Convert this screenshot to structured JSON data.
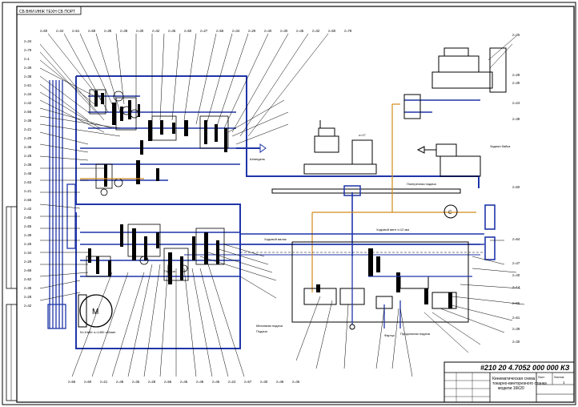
{
  "stamp_top": "СБ ВНИ ИНЖ ТЕХН СБ ПОРТ",
  "doc_code": "#210 20 4.7052 000 000 КЗ",
  "title_block": {
    "title_line1": "Кинематическая схема",
    "title_line2": "токарно-винторезного станка",
    "title_line3": "модели 16К20",
    "sheet_label": "Лист",
    "sheets_label": "Листов",
    "sheet_no": "1",
    "scale": "1:1"
  },
  "callouts": {
    "mechanism_feed": "Механизм подачи",
    "mechanism_feed2": "Подачи",
    "lead_screw": "Ходовой винт",
    "feed_rod": "Ходовой валик",
    "feed_rod2": "Ходовой валик Рn=2.17мм",
    "feed_screw": "Ходовой винт t=12 мм",
    "apron": "Фартук",
    "spindle": "Шпиндель",
    "tailstock": "Задняя бабка",
    "motor": "М",
    "motor_spec": "N=10кВт n=1450 об/мин",
    "tool_feed": "Подача",
    "cross_feed": "Поперечная подача",
    "long_feed": "Продольная подача"
  },
  "left_labels": [
    "z=34",
    "z=79",
    "z=1",
    "z=39",
    "z=38",
    "z=51",
    "z=34",
    "z=42",
    "z=56",
    "z=38",
    "z=21",
    "z=29",
    "z=38",
    "z=28",
    "z=38",
    "z=48",
    "z=53",
    "z=21",
    "z=56",
    "z=42",
    "z=65",
    "z=55",
    "z=39",
    "z=26",
    "z=34",
    "z=29",
    "z=68",
    "z=52",
    "z=36",
    "z=28",
    "z=42"
  ],
  "top_labels": [
    "z=60",
    "z=34",
    "z=51",
    "z=68",
    "z=38",
    "z=48",
    "z=30",
    "z=42",
    "z=45",
    "z=60",
    "z=27",
    "z=56",
    "z=34",
    "z=29",
    "z=40",
    "z=30",
    "z=45",
    "z=32",
    "z=60",
    "z=78"
  ],
  "bottom_labels": [
    "z=55",
    "z=60",
    "z=21",
    "z=48",
    "z=35",
    "z=28",
    "z=56",
    "z=45",
    "z=48",
    "z=45",
    "z=24",
    "z=57",
    "z=30",
    "z=48",
    "z=45"
  ],
  "right_labels": [
    "z=25",
    "z=28",
    "z=30",
    "z=24",
    "z=38",
    "z=50",
    "z=64",
    "z=47",
    "z=40",
    "z=14",
    "z=66",
    "z=61",
    "z=39",
    "z=30"
  ],
  "colors": {
    "blue": "#1f35a8",
    "ink": "#000000",
    "orange": "#d28a1c"
  }
}
